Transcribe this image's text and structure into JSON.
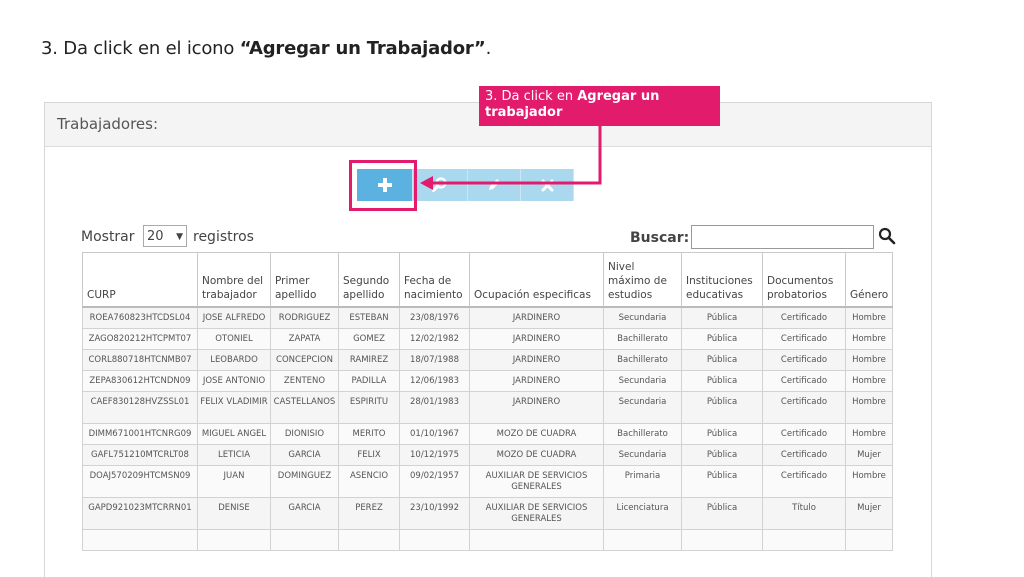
{
  "instruction": {
    "prefix": "3. Da click en el icono ",
    "bold": "“Agregar un Trabajador”",
    "suffix": "."
  },
  "panel": {
    "title": "Trabajadores:"
  },
  "toolbar": {
    "add_icon": "plus-icon",
    "search_icon": "magnifier-icon",
    "edit_icon": "pencil-icon",
    "delete_icon": "x-icon"
  },
  "controls": {
    "show_label": "Mostrar",
    "show_value": "20",
    "records_label": "registros",
    "search_label": "Buscar:",
    "search_value": ""
  },
  "callout": {
    "prefix": "3. Da click en ",
    "bold": "Agregar un trabajador"
  },
  "colors": {
    "accent": "#e31b6d",
    "add_button": "#5bb2e0",
    "toolbar_button": "#a9d8ef"
  },
  "table": {
    "headers": [
      [
        "CURP"
      ],
      [
        "Nombre del",
        "trabajador"
      ],
      [
        "Primer",
        "apellido"
      ],
      [
        "Segundo",
        "apellido"
      ],
      [
        "Fecha de",
        "nacimiento"
      ],
      [
        "Ocupación especificas"
      ],
      [
        "Nivel",
        "máximo de",
        "estudios"
      ],
      [
        "Instituciones",
        "educativas"
      ],
      [
        "Documentos",
        "probatorios"
      ],
      [
        "Género"
      ]
    ],
    "rows": [
      [
        "ROEA760823HTCDSL04",
        "JOSE ALFREDO",
        "RODRIGUEZ",
        "ESTEBAN",
        "23/08/1976",
        "JARDINERO",
        "Secundaria",
        "Pública",
        "Certificado",
        "Hombre"
      ],
      [
        "ZAGO820212HTCPMT07",
        "OTONIEL",
        "ZAPATA",
        "GOMEZ",
        "12/02/1982",
        "JARDINERO",
        "Bachillerato",
        "Pública",
        "Certificado",
        "Hombre"
      ],
      [
        "CORL880718HTCNMB07",
        "LEOBARDO",
        "CONCEPCION",
        "RAMIREZ",
        "18/07/1988",
        "JARDINERO",
        "Bachillerato",
        "Pública",
        "Certificado",
        "Hombre"
      ],
      [
        "ZEPA830612HTCNDN09",
        "JOSE ANTONIO",
        "ZENTENO",
        "PADILLA",
        "12/06/1983",
        "JARDINERO",
        "Secundaria",
        "Pública",
        "Certificado",
        "Hombre"
      ],
      [
        "CAEF830128HVZSSL01",
        "FELIX VLADIMIR",
        "CASTELLANOS",
        "ESPIRITU",
        "28/01/1983",
        "JARDINERO",
        "Secundaria",
        "Pública",
        "Certificado",
        "Hombre"
      ],
      [
        "DIMM671001HTCNRG09",
        "MIGUEL ANGEL",
        "DIONISIO",
        "MERITO",
        "01/10/1967",
        "MOZO DE CUADRA",
        "Bachillerato",
        "Pública",
        "Certificado",
        "Hombre"
      ],
      [
        "GAFL751210MTCRLT08",
        "LETICIA",
        "GARCIA",
        "FELIX",
        "10/12/1975",
        "MOZO DE CUADRA",
        "Secundaria",
        "Pública",
        "Certificado",
        "Mujer"
      ],
      [
        "DOAJ570209HTCMSN09",
        "JUAN",
        "DOMINGUEZ",
        "ASENCIO",
        "09/02/1957",
        "AUXILIAR DE SERVICIOS GENERALES",
        "Primaria",
        "Pública",
        "Certificado",
        "Hombre"
      ],
      [
        "GAPD921023MTCRRN01",
        "DENISE",
        "GARCIA",
        "PEREZ",
        "23/10/1992",
        "AUXILIAR DE SERVICIOS GENERALES",
        "Licenciatura",
        "Pública",
        "Título",
        "Mujer"
      ],
      [
        "",
        "",
        "",
        "",
        "",
        "",
        "",
        "",
        "",
        ""
      ]
    ]
  }
}
